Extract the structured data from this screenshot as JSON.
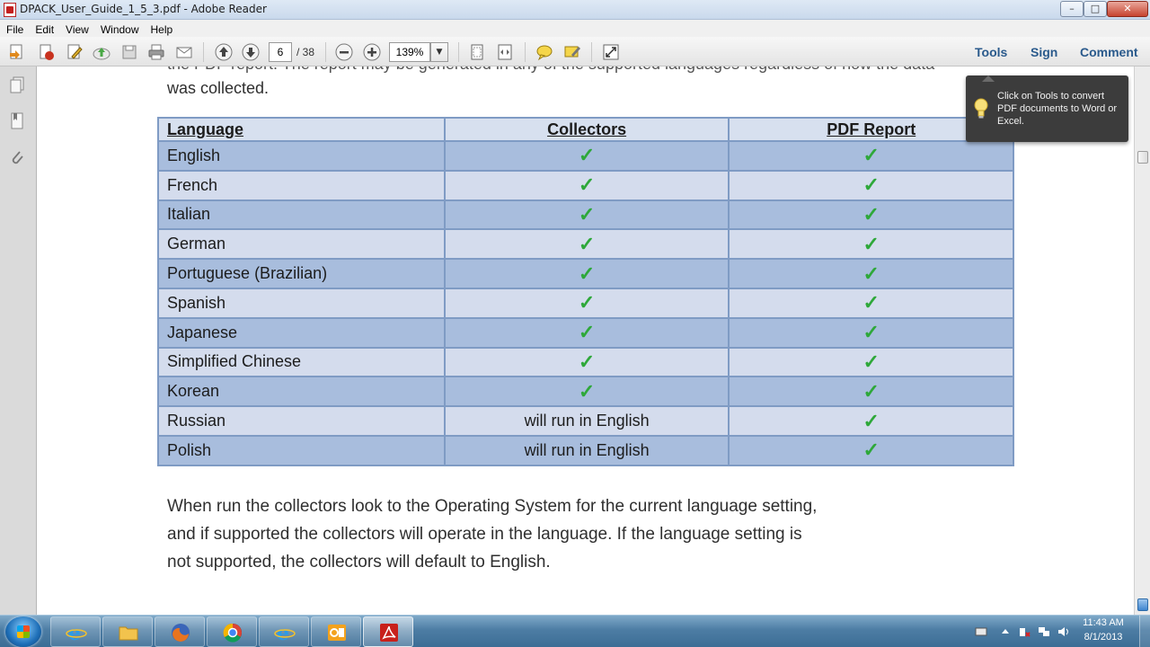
{
  "window": {
    "title": "DPACK_User_Guide_1_5_3.pdf - Adobe Reader",
    "minimize": "–",
    "maximize": "□",
    "close": "✕"
  },
  "menu": {
    "items": [
      "File",
      "Edit",
      "View",
      "Window",
      "Help"
    ]
  },
  "toolbar": {
    "page_current": "6",
    "page_total": "/ 38",
    "zoom": "139%",
    "tools_label": "Tools",
    "sign_label": "Sign",
    "comment_label": "Comment",
    "icons": [
      "create-pdf-icon",
      "open-icon",
      "edit-icon",
      "upload-icon",
      "save-icon",
      "print-icon",
      "email-icon",
      "prev-page-icon",
      "next-page-icon",
      "zoom-out-icon",
      "zoom-in-icon",
      "fit-page-icon",
      "fit-width-icon",
      "comment-icon",
      "highlight-icon",
      "full-screen-icon"
    ]
  },
  "document": {
    "intro_line1": "the PDF report. The report may be generated in any of the supported languages regardless of how the data",
    "intro_line2": "was collected.",
    "table": {
      "headers": [
        "Language",
        "Collectors",
        "PDF Report"
      ],
      "check": "✓",
      "rows": [
        {
          "language": "English",
          "collectors": "✓",
          "pdf_report": "✓"
        },
        {
          "language": "French",
          "collectors": "✓",
          "pdf_report": "✓"
        },
        {
          "language": "Italian",
          "collectors": "✓",
          "pdf_report": "✓"
        },
        {
          "language": "German",
          "collectors": "✓",
          "pdf_report": "✓"
        },
        {
          "language": "Portuguese (Brazilian)",
          "collectors": "✓",
          "pdf_report": "✓"
        },
        {
          "language": "Spanish",
          "collectors": "✓",
          "pdf_report": "✓"
        },
        {
          "language": "Japanese",
          "collectors": "✓",
          "pdf_report": "✓"
        },
        {
          "language": "Simplified Chinese",
          "collectors": "✓",
          "pdf_report": "✓"
        },
        {
          "language": "Korean",
          "collectors": "✓",
          "pdf_report": "✓"
        },
        {
          "language": "Russian",
          "collectors": "will run in English",
          "pdf_report": "✓"
        },
        {
          "language": "Polish",
          "collectors": "will run in English",
          "pdf_report": "✓"
        }
      ]
    },
    "paragraph": {
      "line1": "When run the collectors look to the Operating System for the current language setting,",
      "line2": "and if supported the collectors will operate in the language.  If the language setting is",
      "line3": "not supported, the collectors will default to English."
    }
  },
  "tooltip": {
    "text": "Click on Tools to convert PDF documents to Word or Excel."
  },
  "taskbar": {
    "apps": [
      "internet-explorer",
      "windows-explorer",
      "firefox",
      "chrome",
      "internet-explorer-2",
      "outlook",
      "adobe-reader"
    ],
    "clock_time": "11:43 AM",
    "clock_date": "8/1/2013"
  },
  "colors": {
    "check_green": "#2ea83a",
    "table_border": "#7f9bc4",
    "row_dark": "#a8bddd",
    "row_light": "#d4dced",
    "header_bg": "#d7e0ef",
    "pane_link": "#2a5a8c"
  }
}
